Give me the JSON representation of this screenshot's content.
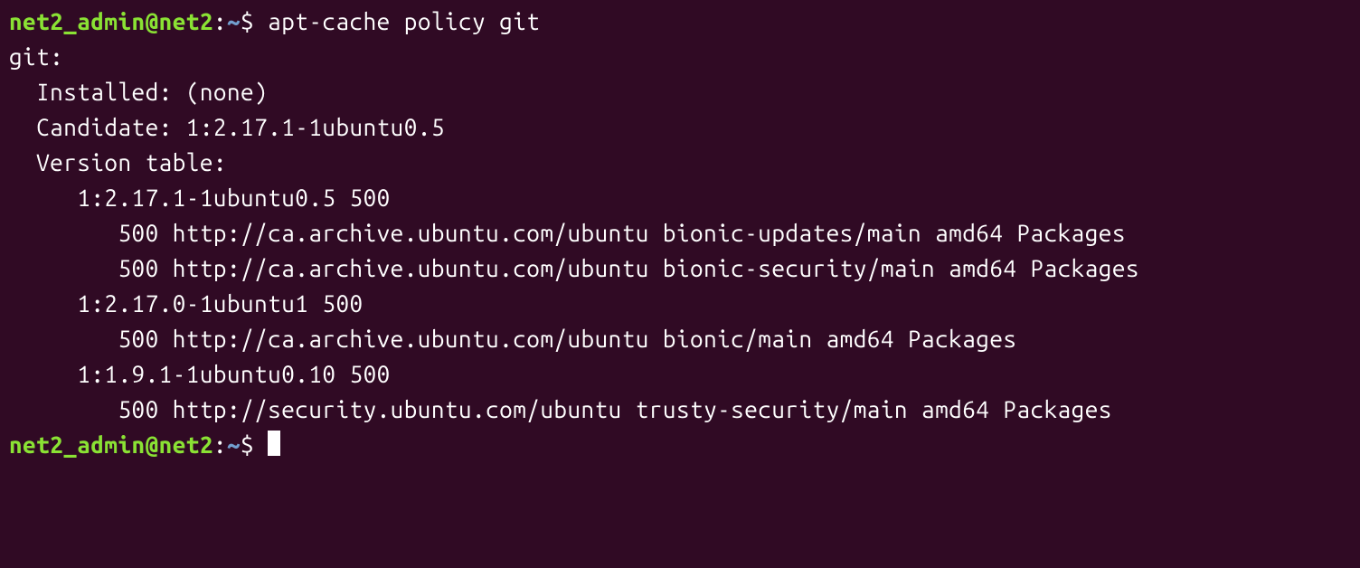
{
  "prompt1": {
    "userhost": "net2_admin@net2",
    "colon": ":",
    "path": "~",
    "dollar": "$ ",
    "command": "apt-cache policy git"
  },
  "output": {
    "line1": "git:",
    "line2": "  Installed: (none)",
    "line3": "  Candidate: 1:2.17.1-1ubuntu0.5",
    "line4": "  Version table:",
    "line5": "     1:2.17.1-1ubuntu0.5 500",
    "line6": "        500 http://ca.archive.ubuntu.com/ubuntu bionic-updates/main amd64 Packages",
    "line7": "        500 http://ca.archive.ubuntu.com/ubuntu bionic-security/main amd64 Packages",
    "line8": "     1:2.17.0-1ubuntu1 500",
    "line9": "        500 http://ca.archive.ubuntu.com/ubuntu bionic/main amd64 Packages",
    "line10": "     1:1.9.1-1ubuntu0.10 500",
    "line11": "        500 http://security.ubuntu.com/ubuntu trusty-security/main amd64 Packages"
  },
  "prompt2": {
    "userhost": "net2_admin@net2",
    "colon": ":",
    "path": "~",
    "dollar": "$ "
  }
}
